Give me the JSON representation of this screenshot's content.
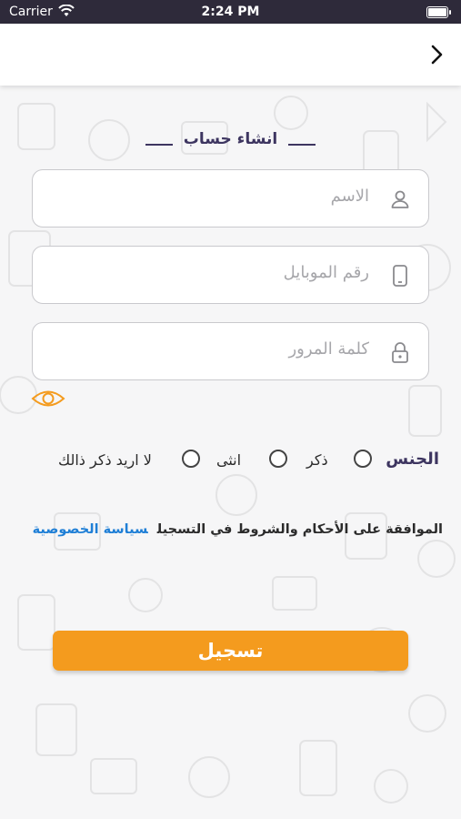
{
  "status_bar": {
    "carrier": "Carrier",
    "time": "2:24 PM"
  },
  "nav": {
    "back_icon": "chevron-right-icon"
  },
  "form": {
    "title": "انشاء حساب",
    "name_placeholder": "الاسم",
    "mobile_placeholder": "رقم الموبايل",
    "password_placeholder": "كلمة المرور",
    "show_password_icon": "eye-icon"
  },
  "gender": {
    "label": "الجنس",
    "options": [
      "ذكر",
      "انثى",
      "لا اريد ذكر ذالك"
    ]
  },
  "terms": {
    "text": "الموافقة على الأحكام والشروط في التسجيل",
    "link": "سياسة الخصوصية"
  },
  "submit_label": "تسجيل",
  "colors": {
    "primary": "#3d3560",
    "accent": "#f49b1e",
    "link": "#1f7fd6",
    "statusbar": "#2e2a3a"
  }
}
